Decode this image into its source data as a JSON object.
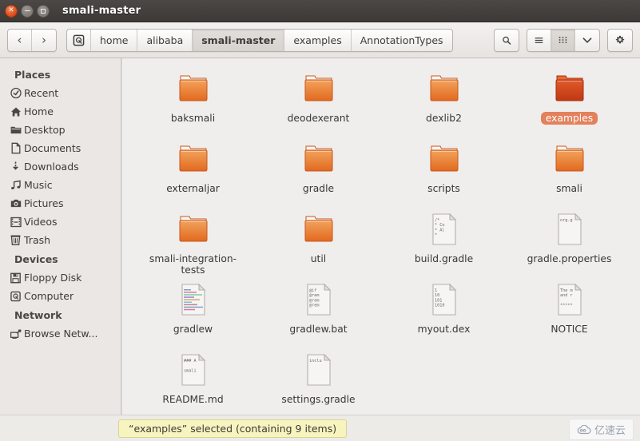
{
  "window": {
    "title": "smali-master",
    "controls": [
      {
        "name": "close-button",
        "icon": "close-icon",
        "glyph": "×"
      },
      {
        "name": "minimize-button",
        "icon": "minimize-icon",
        "glyph": "–"
      },
      {
        "name": "maximize-button",
        "icon": "maximize-icon",
        "glyph": "□"
      }
    ]
  },
  "toolbar": {
    "back_label": "‹",
    "forward_label": "›",
    "breadcrumbs": [
      {
        "label": "",
        "icon": "device-disk-icon",
        "current": false
      },
      {
        "label": "home",
        "icon": "",
        "current": false
      },
      {
        "label": "alibaba",
        "icon": "",
        "current": false
      },
      {
        "label": "smali-master",
        "icon": "",
        "current": true
      },
      {
        "label": "examples",
        "icon": "",
        "current": false
      },
      {
        "label": "AnnotationTypes",
        "icon": "",
        "current": false
      }
    ],
    "search_icon": "search-icon",
    "list_view_icon": "list-view-icon",
    "grid_view_icon": "grid-view-icon",
    "dropdown_icon": "chevron-down-icon",
    "settings_icon": "gear-icon"
  },
  "sidebar": {
    "sections": [
      {
        "heading": "Places",
        "items": [
          {
            "label": "Recent",
            "icon": "clock-icon"
          },
          {
            "label": "Home",
            "icon": "home-icon"
          },
          {
            "label": "Desktop",
            "icon": "desktop-folder-icon"
          },
          {
            "label": "Documents",
            "icon": "document-icon"
          },
          {
            "label": "Downloads",
            "icon": "download-icon"
          },
          {
            "label": "Music",
            "icon": "music-note-icon"
          },
          {
            "label": "Pictures",
            "icon": "camera-icon"
          },
          {
            "label": "Videos",
            "icon": "film-icon"
          },
          {
            "label": "Trash",
            "icon": "trash-icon"
          }
        ]
      },
      {
        "heading": "Devices",
        "items": [
          {
            "label": "Floppy Disk",
            "icon": "floppy-disk-icon"
          },
          {
            "label": "Computer",
            "icon": "computer-disk-icon"
          }
        ]
      },
      {
        "heading": "Network",
        "items": [
          {
            "label": "Browse Netw...",
            "icon": "network-icon"
          }
        ]
      }
    ]
  },
  "files": [
    {
      "name": "baksmali",
      "type": "folder",
      "selected": false,
      "preview": []
    },
    {
      "name": "deodexerant",
      "type": "folder",
      "selected": false,
      "preview": []
    },
    {
      "name": "dexlib2",
      "type": "folder",
      "selected": false,
      "preview": []
    },
    {
      "name": "examples",
      "type": "folder",
      "selected": true,
      "preview": []
    },
    {
      "name": "externaljar",
      "type": "folder",
      "selected": false,
      "preview": []
    },
    {
      "name": "gradle",
      "type": "folder",
      "selected": false,
      "preview": []
    },
    {
      "name": "scripts",
      "type": "folder",
      "selected": false,
      "preview": []
    },
    {
      "name": "smali",
      "type": "folder",
      "selected": false,
      "preview": []
    },
    {
      "name": "smali-integration-tests",
      "type": "folder",
      "selected": false,
      "preview": []
    },
    {
      "name": "util",
      "type": "folder",
      "selected": false,
      "preview": []
    },
    {
      "name": "build.gradle",
      "type": "text",
      "selected": false,
      "preview": [
        "/*",
        " * Co",
        " * Al",
        " *"
      ]
    },
    {
      "name": "gradle.properties",
      "type": "text",
      "selected": false,
      "preview": [
        "org.g"
      ]
    },
    {
      "name": "gradlew",
      "type": "code",
      "selected": false,
      "preview": []
    },
    {
      "name": "gradlew.bat",
      "type": "text",
      "selected": false,
      "preview": [
        "@if",
        "@rem",
        "@rem",
        "@rem"
      ]
    },
    {
      "name": "myout.dex",
      "type": "text",
      "selected": false,
      "preview": [
        "1",
        "10",
        "101",
        "1010"
      ]
    },
    {
      "name": "NOTICE",
      "type": "text",
      "selected": false,
      "preview": [
        "The m",
        "and  r",
        "",
        "*****"
      ]
    },
    {
      "name": "README.md",
      "type": "text",
      "selected": false,
      "preview": [
        "### A",
        "",
        "smali"
      ]
    },
    {
      "name": "settings.gradle",
      "type": "text",
      "selected": false,
      "preview": [
        "inclu"
      ]
    }
  ],
  "statusbar": {
    "text": "“examples” selected (containing 9 items)"
  },
  "watermark": {
    "text": "亿速云",
    "icon": "cloud-icon"
  },
  "colors": {
    "titlebar": "#3f3c39",
    "folder": "#e8742c",
    "folder_selected": "#c9401a",
    "selection_pill": "#e3815d",
    "status_bg": "#f8f4bf",
    "pane_bg": "#efeeec"
  }
}
